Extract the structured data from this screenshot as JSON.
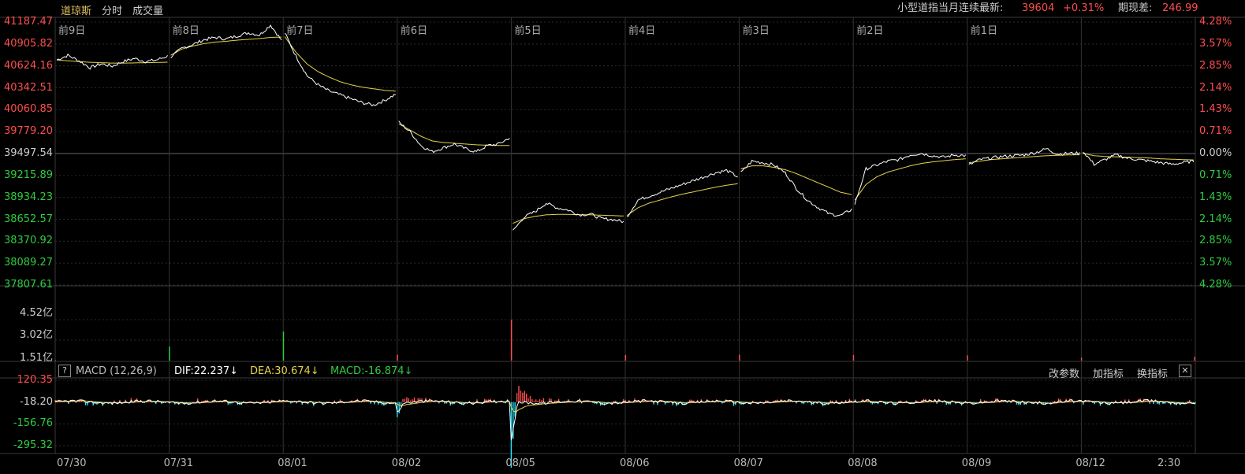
{
  "header": {
    "tabs": [
      {
        "label": "道琼斯",
        "active": true
      },
      {
        "label": "分时",
        "active": false
      },
      {
        "label": "成交量",
        "active": false
      }
    ],
    "contract_label": "小型道指当月连续最新:",
    "latest_price": "39604",
    "change_pct": "+0.31%",
    "basis_label": "期现差:",
    "basis_value": "246.99"
  },
  "price_panel": {
    "left_ticks": [
      "41187.47",
      "40905.82",
      "40624.16",
      "40342.51",
      "40060.85",
      "39779.20",
      "39497.54",
      "39215.89",
      "38934.23",
      "38652.57",
      "38370.92",
      "38089.27",
      "37807.61"
    ],
    "right_ticks": [
      "4.28%",
      "3.57%",
      "2.85%",
      "2.14%",
      "1.43%",
      "0.71%",
      "0.00%",
      "0.71%",
      "1.43%",
      "2.14%",
      "2.85%",
      "3.57%",
      "4.28%"
    ],
    "day_labels": [
      "前9日",
      "前8日",
      "前7日",
      "前6日",
      "前5日",
      "前4日",
      "前3日",
      "前2日",
      "前1日"
    ]
  },
  "volume_panel": {
    "ticks": [
      "4.52亿",
      "3.02亿",
      "1.51亿"
    ]
  },
  "macd_panel": {
    "help_label": "?",
    "name": "MACD (12,26,9)",
    "dif_text": "DIF:22.237↓",
    "dea_text": "DEA:30.674↓",
    "macd_text": "MACD:-16.874↓",
    "buttons": [
      "改参数",
      "加指标",
      "换指标"
    ],
    "close_label": "✕",
    "ticks": [
      "120.35",
      "-18.20",
      "-156.76",
      "-295.32"
    ]
  },
  "x_axis": {
    "labels": [
      "07/30",
      "07/31",
      "08/01",
      "08/02",
      "08/05",
      "08/06",
      "08/07",
      "08/08",
      "08/09",
      "08/12",
      "2:30"
    ]
  },
  "colors": {
    "price_line": "#ffffff",
    "avg_line": "#e6d34a",
    "up": "#ff4d4d",
    "down": "#2ecc40",
    "dif": "#ffffff",
    "dea": "#e6d34a",
    "macd_pos": "#ff4d4d",
    "macd_neg": "#22e5ff",
    "grid": "#2a2a2a",
    "divider": "#3a3a3a"
  },
  "chart_data": {
    "type": "line",
    "ylim": [
      37807.61,
      41187.47
    ],
    "base_value": 39497.54,
    "days": [
      {
        "label": "前9日",
        "price": [
          40700,
          40760,
          40690,
          40600,
          40650,
          40620,
          40680,
          40720,
          40680,
          40700,
          40750
        ],
        "avg": [
          40700,
          40690,
          40680,
          40670,
          40665,
          40660,
          40660,
          40662,
          40665,
          40668,
          40672
        ]
      },
      {
        "label": "前8日",
        "price": [
          40740,
          40850,
          40900,
          40960,
          40990,
          40970,
          41010,
          41050,
          41020,
          41150,
          40950
        ],
        "avg": [
          40760,
          40840,
          40880,
          40910,
          40930,
          40940,
          40955,
          40965,
          40975,
          40990,
          40995
        ]
      },
      {
        "label": "前7日",
        "price": [
          41050,
          40750,
          40500,
          40380,
          40300,
          40250,
          40200,
          40150,
          40120,
          40180,
          40260
        ],
        "avg": [
          41000,
          40800,
          40650,
          40550,
          40480,
          40420,
          40380,
          40350,
          40330,
          40310,
          40300
        ]
      },
      {
        "label": "前6日",
        "price": [
          39900,
          39780,
          39600,
          39520,
          39570,
          39620,
          39560,
          39520,
          39600,
          39620,
          39700
        ],
        "avg": [
          39880,
          39800,
          39720,
          39660,
          39640,
          39630,
          39620,
          39610,
          39605,
          39602,
          39600
        ]
      },
      {
        "label": "前5日",
        "price": [
          38500,
          38680,
          38750,
          38860,
          38800,
          38770,
          38710,
          38720,
          38660,
          38650,
          38620
        ],
        "avg": [
          38600,
          38660,
          38690,
          38710,
          38715,
          38715,
          38712,
          38710,
          38705,
          38700,
          38695
        ]
      },
      {
        "label": "前4日",
        "price": [
          38680,
          38900,
          38950,
          39000,
          39050,
          39100,
          39150,
          39200,
          39250,
          39280,
          39200
        ],
        "avg": [
          38700,
          38800,
          38860,
          38900,
          38940,
          38975,
          39005,
          39035,
          39065,
          39090,
          39110
        ]
      },
      {
        "label": "前3日",
        "price": [
          39250,
          39400,
          39380,
          39350,
          39250,
          39050,
          38900,
          38800,
          38720,
          38700,
          38780
        ],
        "avg": [
          39300,
          39340,
          39340,
          39320,
          39290,
          39240,
          39180,
          39120,
          39060,
          39000,
          38970
        ]
      },
      {
        "label": "前2日",
        "price": [
          38850,
          39300,
          39350,
          39400,
          39420,
          39480,
          39500,
          39470,
          39450,
          39480,
          39470
        ],
        "avg": [
          38900,
          39100,
          39200,
          39260,
          39300,
          39340,
          39370,
          39390,
          39405,
          39420,
          39430
        ]
      },
      {
        "label": "前1日",
        "price": [
          39350,
          39420,
          39440,
          39460,
          39470,
          39480,
          39510,
          39560,
          39490,
          39500,
          39500
        ],
        "avg": [
          39380,
          39400,
          39420,
          39430,
          39440,
          39450,
          39460,
          39470,
          39475,
          39480,
          39482
        ]
      },
      {
        "label": "",
        "price": [
          39530,
          39360,
          39420,
          39480,
          39440,
          39420,
          39400,
          39380,
          39360,
          39380,
          39400
        ],
        "avg": [
          39500,
          39470,
          39460,
          39455,
          39450,
          39445,
          39440,
          39430,
          39425,
          39420,
          39415
        ]
      }
    ],
    "volume": {
      "unit": "亿",
      "ylim": [
        0,
        4.52
      ],
      "series": [
        {
          "name": "",
          "values": [
            0.05,
            1.55,
            3.21,
            0.65,
            4.52,
            0.62,
            0.65,
            0.62,
            0.58,
            0.33,
            0.42
          ]
        }
      ]
    },
    "macd": {
      "ylim": [
        -295.32,
        120.35
      ],
      "base_value": -18.2
    }
  }
}
